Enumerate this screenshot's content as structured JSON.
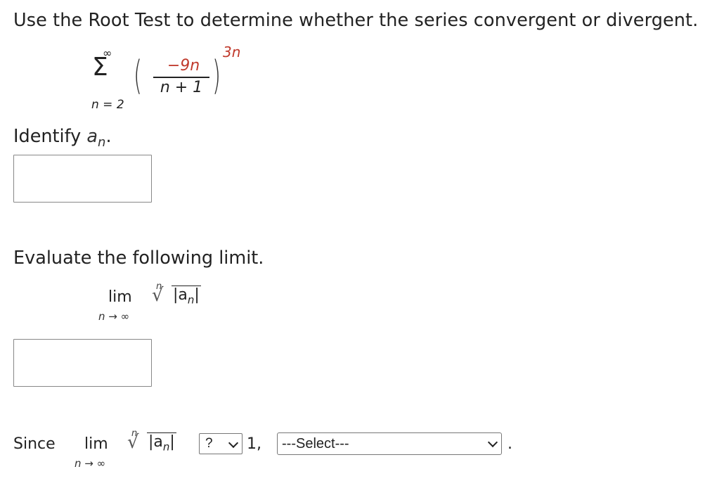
{
  "prompt": "Use the Root Test to determine whether the series convergent or divergent.",
  "series": {
    "upper_limit": "∞",
    "lower_limit": "n = 2",
    "numerator": "−9n",
    "denominator": "n + 1",
    "exponent": "3n"
  },
  "identify": {
    "text": "Identify",
    "symbol": "a",
    "subscript": "n",
    "suffix": "."
  },
  "answer_an": {
    "value": ""
  },
  "evaluate": {
    "text": "Evaluate the following limit."
  },
  "limit_expr": {
    "lim": "lim",
    "sub": "n → ∞",
    "root_index": "n",
    "radical": "√",
    "radicand_a": "|a",
    "radicand_n": "n",
    "radicand_end": "|"
  },
  "answer_limit": {
    "value": ""
  },
  "since_row": {
    "since": "Since",
    "lim": "lim",
    "sub": "n → ∞",
    "root_index": "n",
    "radical": "√",
    "radicand_a": "|a",
    "radicand_n": "n",
    "radicand_end": "|",
    "comparison_select": "?",
    "one": "1,",
    "verdict_select": "---Select---",
    "period": "."
  },
  "colors": {
    "exponent": "#c0392b",
    "numerator_n": "#c0392b"
  }
}
